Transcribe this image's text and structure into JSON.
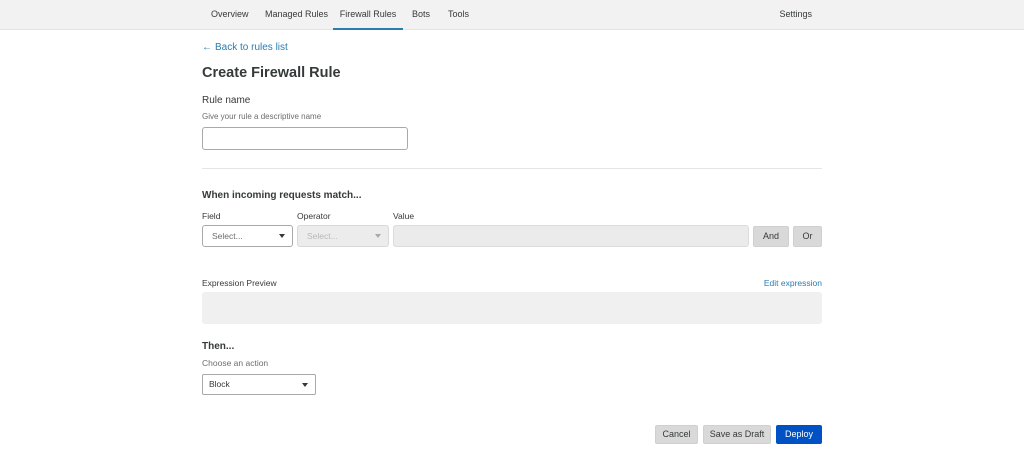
{
  "nav": {
    "tabs": [
      {
        "label": "Overview"
      },
      {
        "label": "Managed Rules"
      },
      {
        "label": "Firewall Rules"
      },
      {
        "label": "Bots"
      },
      {
        "label": "Tools"
      }
    ],
    "active_tab": "Firewall Rules",
    "settings_label": "Settings"
  },
  "back_link": {
    "arrow": "←",
    "label": "Back to rules list"
  },
  "page_title": "Create Firewall Rule",
  "rule_name": {
    "label": "Rule name",
    "hint": "Give your rule a descriptive name",
    "value": ""
  },
  "match_section": {
    "title": "When incoming requests match...",
    "field_label": "Field",
    "operator_label": "Operator",
    "value_label": "Value",
    "field_placeholder": "Select...",
    "operator_placeholder": "Select...",
    "value": "",
    "and_button": "And",
    "or_button": "Or"
  },
  "expression_preview": {
    "label": "Expression Preview",
    "edit_link": "Edit expression",
    "content": ""
  },
  "then_section": {
    "title": "Then...",
    "hint": "Choose an action",
    "action_value": "Block"
  },
  "footer": {
    "cancel_label": "Cancel",
    "save_draft_label": "Save as Draft",
    "deploy_label": "Deploy"
  },
  "colors": {
    "link": "#2c7cb0",
    "primary_button": "#0051c3",
    "nav_background": "#f2f2f2",
    "active_tab_underline": "#2c7cb0"
  }
}
